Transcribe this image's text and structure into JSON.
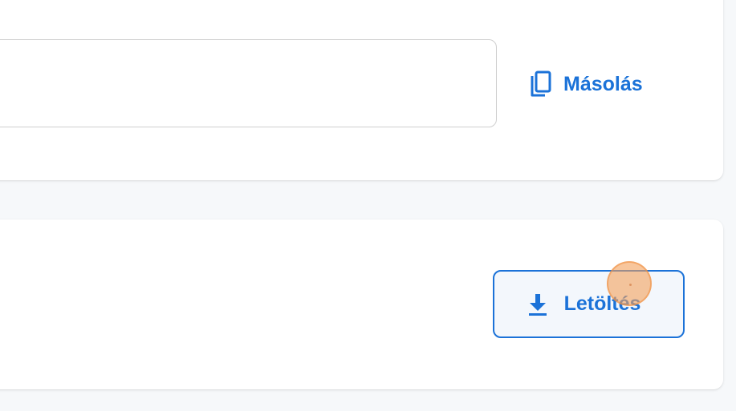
{
  "colors": {
    "accent": "#1b72d8",
    "page_background": "#f6f8fa",
    "card_background": "#ffffff",
    "field_border": "#cfcfcf",
    "cursor_highlight": "#f4a05a"
  },
  "copy_section": {
    "field_value": "",
    "copy_button": {
      "label": "Másolás",
      "icon": "copy-icon"
    }
  },
  "download_section": {
    "download_button": {
      "label": "Letöltés",
      "icon": "download-icon"
    }
  }
}
